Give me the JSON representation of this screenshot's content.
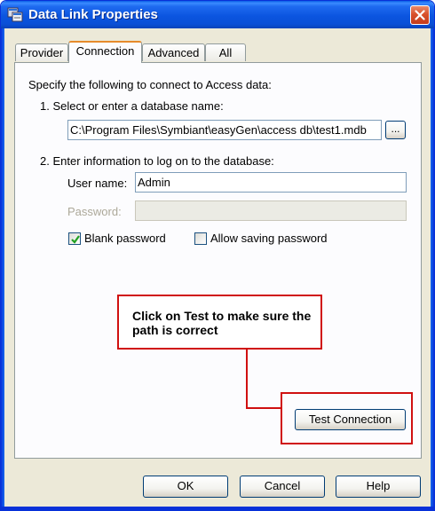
{
  "window": {
    "title": "Data Link Properties",
    "icon": "data-link-icon",
    "close_icon": "close-icon"
  },
  "tabs": [
    {
      "label": "Provider",
      "active": false
    },
    {
      "label": "Connection",
      "active": true
    },
    {
      "label": "Advanced",
      "active": false
    },
    {
      "label": "All",
      "active": false
    }
  ],
  "connection": {
    "intro": "Specify the following to connect to Access data:",
    "step1_label": "1. Select or enter a database name:",
    "database_path": "C:\\Program Files\\Symbiant\\easyGen\\access db\\test1.mdb",
    "browse_label": "...",
    "step2_label": "2. Enter information to log on to the database:",
    "username_label": "User name:",
    "username_value": "Admin",
    "password_label": "Password:",
    "password_value": "",
    "blank_password_label": "Blank password",
    "blank_password_checked": true,
    "allow_saving_label": "Allow saving password",
    "allow_saving_checked": false,
    "test_button_label": "Test Connection"
  },
  "annotation": {
    "text": "Click on Test to make sure the path is correct",
    "color": "#d01010"
  },
  "footer": {
    "ok_label": "OK",
    "cancel_label": "Cancel",
    "help_label": "Help"
  },
  "colors": {
    "titlebar": "#0a4fd6",
    "dialog_bg": "#ece9d8",
    "active_tab_accent": "#e68b2c",
    "close_button": "#d8512c"
  }
}
